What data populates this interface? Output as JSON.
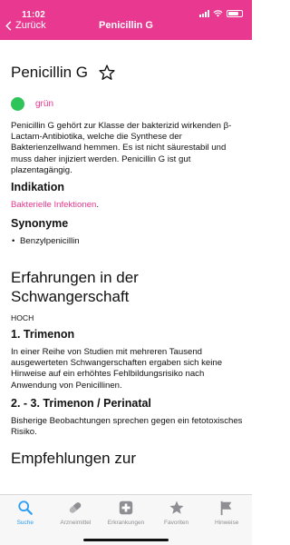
{
  "status_bar": {
    "time": "11:02"
  },
  "nav": {
    "back_label": "Zurück",
    "title": "Penicillin G"
  },
  "drug": {
    "title": "Penicillin G",
    "category_label": "grün",
    "category_color": "#2fc45a",
    "description": "Penicillin G gehört zur Klasse der bakterizid wirkenden  β-Lactam-Antibiotika, welche die Synthese der Bakterienzellwand hemmen. Es ist nicht säurestabil und muss daher injiziert werden. Penicillin G ist gut plazentagängig.",
    "indication_heading": "Indikation",
    "indication_link": "Bakterielle Infektionen",
    "indication_suffix": ".",
    "synonyms_heading": "Synonyme",
    "synonyms": [
      "Benzylpenicillin"
    ]
  },
  "pregnancy": {
    "heading": "Erfahrungen in der Schwangerschaft",
    "level": "HOCH",
    "trimester1_heading": "1. Trimenon",
    "trimester1_text": "In einer Reihe von Studien mit mehreren Tausend ausgewerteten Schwangerschaften ergaben sich keine Hinweise auf ein erhöhtes Fehlbildungsrisiko nach Anwendung von Penicillinen.",
    "trimester23_heading": "2. - 3. Trimenon / Perinatal",
    "trimester23_text": "Bisherige Beobachtungen sprechen gegen ein fetotoxisches Risiko.",
    "next_heading": "Empfehlungen zur"
  },
  "tabbar": {
    "items": [
      {
        "label": "Suche",
        "icon": "search-icon",
        "active": true
      },
      {
        "label": "Arzneimittel",
        "icon": "pill-icon",
        "active": false
      },
      {
        "label": "Erkrankungen",
        "icon": "medical-cross-icon",
        "active": false
      },
      {
        "label": "Favoriten",
        "icon": "star-icon",
        "active": false
      },
      {
        "label": "Hinweise",
        "icon": "flag-icon",
        "active": false
      }
    ]
  },
  "colors": {
    "accent": "#e8388f",
    "tab_active": "#2a9df4",
    "tab_inactive": "#8e8e93"
  }
}
